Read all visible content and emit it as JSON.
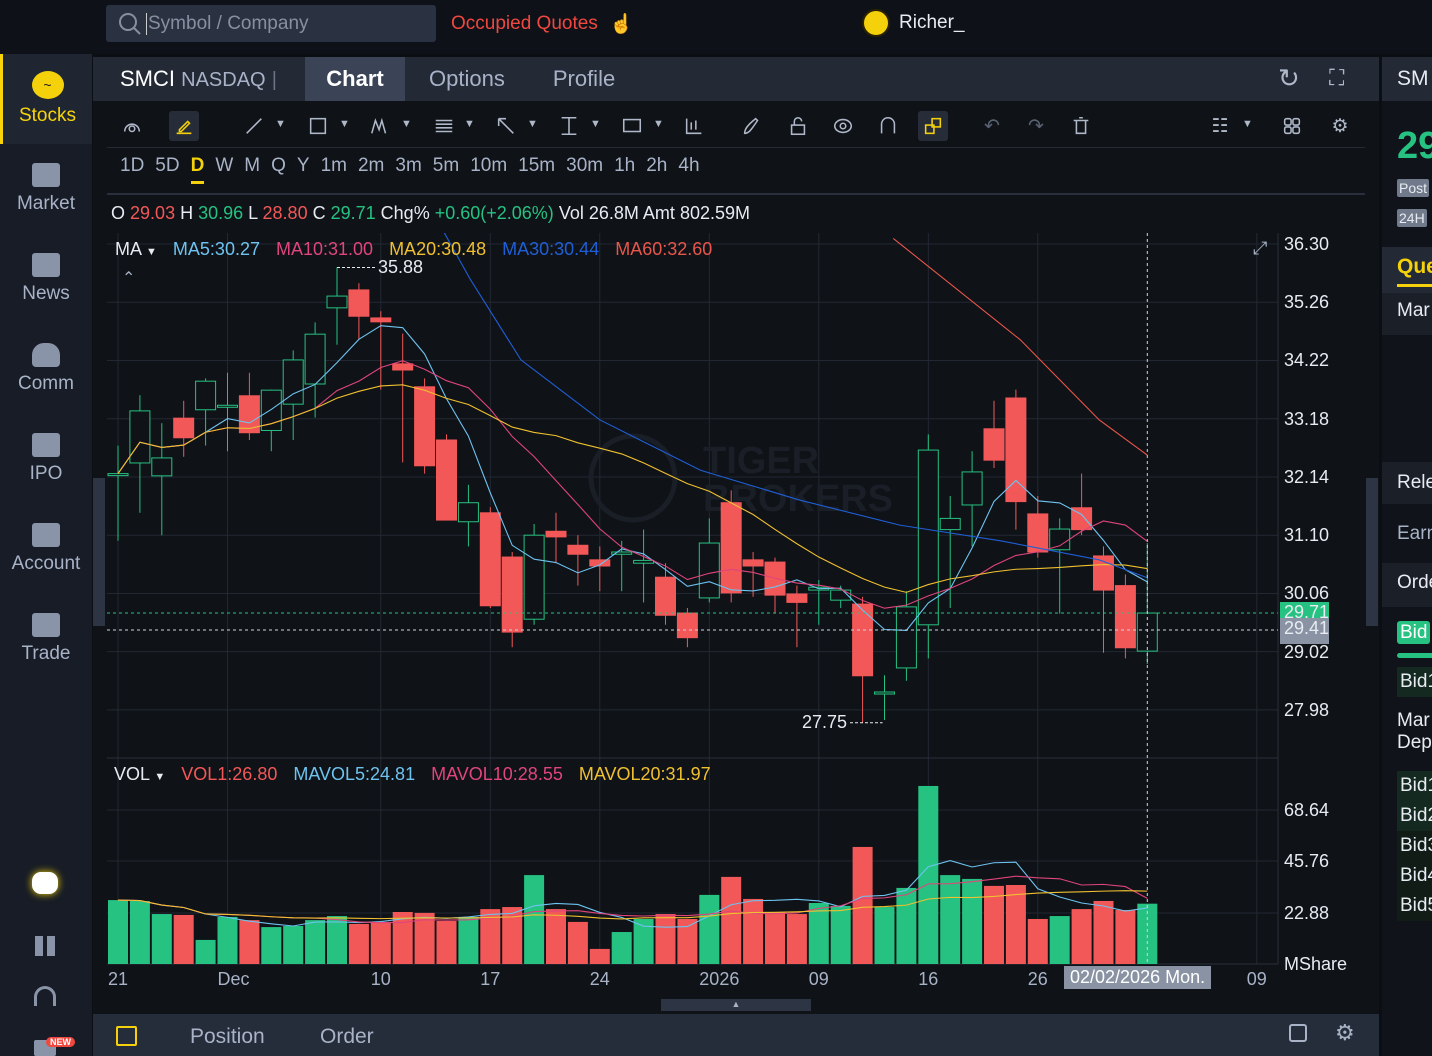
{
  "topbar": {
    "search_placeholder": "Symbol / Company",
    "occupied_quotes": "Occupied Quotes",
    "username": "Richer_"
  },
  "sidebar": {
    "items": [
      {
        "label": "Stocks",
        "icon": "stocks-icon"
      },
      {
        "label": "Market",
        "icon": "market-icon"
      },
      {
        "label": "News",
        "icon": "news-icon"
      },
      {
        "label": "Comm",
        "icon": "community-icon"
      },
      {
        "label": "IPO",
        "icon": "ipo-icon"
      },
      {
        "label": "Account",
        "icon": "wallet-icon"
      },
      {
        "label": "Trade",
        "icon": "trade-icon"
      }
    ],
    "new_badge": "NEW"
  },
  "header": {
    "symbol": "SMCI",
    "exchange": "NASDAQ",
    "tabs": [
      "Chart",
      "Options",
      "Profile"
    ]
  },
  "timeframes": [
    "1D",
    "5D",
    "D",
    "W",
    "M",
    "Q",
    "Y",
    "1m",
    "2m",
    "3m",
    "5m",
    "10m",
    "15m",
    "30m",
    "1h",
    "2h",
    "4h"
  ],
  "active_timeframe": "D",
  "ohlc": {
    "o_label": "O",
    "o": "29.03",
    "h_label": "H",
    "h": "30.96",
    "l_label": "L",
    "l": "28.80",
    "c_label": "C",
    "c": "29.71",
    "chg_label": "Chg%",
    "chg": "+0.60(+2.06%)",
    "vol_label": "Vol",
    "vol": "26.8M",
    "amt_label": "Amt",
    "amt": "802.59M"
  },
  "ma_legend": {
    "label": "MA",
    "ma5": "MA5:30.27",
    "ma10": "MA10:31.00",
    "ma20": "MA20:30.48",
    "ma30": "MA30:30.44",
    "ma60": "MA60:32.60"
  },
  "vol_legend": {
    "label": "VOL",
    "vol1": "VOL1:26.80",
    "mavol5": "MAVOL5:24.81",
    "mavol10": "MAVOL10:28.55",
    "mavol20": "MAVOL20:31.97"
  },
  "colors": {
    "up": "#26c281",
    "down": "#f25858",
    "ma5": "#6ec3f0",
    "ma10": "#e0457b",
    "ma20": "#f0c030",
    "ma30": "#1f5fd6",
    "ma60": "#e8564a",
    "accent": "#f4d10b"
  },
  "chart_data": {
    "type": "candlestick",
    "price_ticks": [
      "36.30",
      "35.26",
      "34.22",
      "33.18",
      "32.14",
      "31.10",
      "30.06",
      "29.02",
      "27.98"
    ],
    "price_range": [
      27.98,
      36.3
    ],
    "last_price": "29.71",
    "crosshair_price": "29.41",
    "high_marker": "35.88",
    "low_marker": "27.75",
    "volume_ticks": [
      "68.64",
      "45.76",
      "22.88"
    ],
    "volume_unit": "MShare",
    "x_labels": [
      {
        "i": 0,
        "t": "21"
      },
      {
        "i": 5,
        "t": "Dec"
      },
      {
        "i": 12,
        "t": "10"
      },
      {
        "i": 17,
        "t": "17"
      },
      {
        "i": 22,
        "t": "24"
      },
      {
        "i": 27,
        "t": "2026"
      },
      {
        "i": 32,
        "t": "09"
      },
      {
        "i": 37,
        "t": "16"
      },
      {
        "i": 42,
        "t": "26"
      },
      {
        "i": 52,
        "t": "09"
      }
    ],
    "crosshair_date": "02/02/2026 Mon.",
    "candles": [
      [
        32.17,
        32.7,
        31.0,
        32.2
      ],
      [
        32.39,
        33.6,
        31.5,
        33.32
      ],
      [
        32.16,
        33.1,
        31.1,
        32.48
      ],
      [
        33.19,
        33.5,
        32.5,
        32.84
      ],
      [
        33.34,
        33.9,
        32.7,
        33.85
      ],
      [
        33.4,
        34.0,
        32.6,
        33.42
      ],
      [
        33.59,
        34.0,
        32.8,
        32.93
      ],
      [
        32.97,
        33.7,
        32.6,
        33.69
      ],
      [
        33.44,
        34.4,
        32.8,
        34.23
      ],
      [
        33.8,
        34.9,
        33.2,
        34.69
      ],
      [
        35.16,
        35.88,
        34.5,
        35.37
      ],
      [
        35.48,
        35.6,
        34.6,
        35.01
      ],
      [
        34.98,
        35.1,
        33.7,
        34.91
      ],
      [
        34.16,
        34.7,
        32.4,
        34.05
      ],
      [
        33.75,
        33.9,
        32.2,
        32.34
      ],
      [
        32.8,
        32.9,
        31.4,
        31.37
      ],
      [
        31.34,
        32.0,
        30.9,
        31.68
      ],
      [
        31.5,
        31.6,
        29.8,
        29.84
      ],
      [
        30.71,
        30.8,
        29.1,
        29.37
      ],
      [
        29.6,
        31.3,
        29.5,
        31.1
      ],
      [
        31.17,
        31.5,
        30.6,
        31.07
      ],
      [
        30.92,
        31.1,
        30.2,
        30.76
      ],
      [
        30.66,
        30.9,
        30.1,
        30.55
      ],
      [
        30.76,
        31.0,
        30.1,
        30.8
      ],
      [
        30.6,
        31.2,
        29.9,
        30.65
      ],
      [
        30.35,
        30.6,
        29.5,
        29.67
      ],
      [
        29.71,
        29.8,
        29.1,
        29.27
      ],
      [
        29.98,
        31.4,
        29.9,
        30.96
      ],
      [
        31.68,
        31.9,
        29.9,
        30.07
      ],
      [
        30.66,
        30.8,
        30.0,
        30.55
      ],
      [
        30.62,
        30.7,
        29.7,
        30.03
      ],
      [
        30.05,
        30.2,
        29.1,
        29.9
      ],
      [
        30.12,
        30.3,
        29.5,
        30.17
      ],
      [
        29.94,
        30.2,
        29.8,
        30.12
      ],
      [
        29.87,
        30.0,
        27.75,
        28.59
      ],
      [
        28.27,
        28.6,
        27.8,
        28.3
      ],
      [
        28.73,
        30.1,
        28.5,
        29.82
      ],
      [
        29.5,
        32.9,
        28.9,
        32.62
      ],
      [
        31.2,
        31.8,
        29.8,
        31.4
      ],
      [
        31.64,
        32.6,
        30.9,
        32.23
      ],
      [
        33.0,
        33.5,
        32.3,
        32.44
      ],
      [
        33.55,
        33.7,
        31.2,
        31.7
      ],
      [
        31.48,
        31.8,
        30.7,
        30.8
      ],
      [
        30.84,
        31.4,
        29.7,
        31.21
      ],
      [
        31.59,
        32.2,
        31.1,
        31.2
      ],
      [
        30.73,
        30.9,
        29.0,
        30.12
      ],
      [
        30.2,
        30.4,
        28.9,
        29.09
      ],
      [
        29.03,
        30.96,
        28.8,
        29.71
      ]
    ],
    "volumes": [
      28.4,
      28,
      22.2,
      21.8,
      10.7,
      20.9,
      19.5,
      16.4,
      16.9,
      19.5,
      21.3,
      17.8,
      18.7,
      23.1,
      22.7,
      19.1,
      20.9,
      24.4,
      25.3,
      39.5,
      24.4,
      18.7,
      6.7,
      14.2,
      20,
      22.2,
      20,
      30.7,
      38.7,
      28.9,
      23.1,
      22.2,
      27.1,
      25.8,
      52,
      25.3,
      33.8,
      79.1,
      39.5,
      37.8,
      34.7,
      35.1,
      20,
      21.3,
      24.4,
      28,
      24,
      26.8
    ],
    "ma30_points": [
      [
        14.9,
        36.5
      ],
      [
        16.1,
        35.66
      ],
      [
        18.4,
        34.23
      ],
      [
        22,
        33.16
      ],
      [
        26.6,
        32.26
      ],
      [
        31.1,
        31.73
      ],
      [
        35.7,
        31.28
      ],
      [
        40.3,
        31.0
      ],
      [
        44.8,
        30.66
      ],
      [
        47,
        30.34
      ]
    ],
    "ma60_points": [
      [
        35.4,
        36.4
      ],
      [
        41.2,
        34.59
      ],
      [
        44.8,
        33.16
      ],
      [
        47,
        32.53
      ]
    ]
  },
  "bottom": {
    "position": "Position",
    "order": "Order"
  },
  "right_panel": {
    "symbol": "SM",
    "price": "29",
    "post": "Post",
    "h24": "24H",
    "quote_tab": "Que",
    "market": "Mar",
    "related": "Rele",
    "earnings": "Earn",
    "order": "Orde",
    "bid": "Bid",
    "bid1_top": "Bid1",
    "market_depth_1": "Mar",
    "market_depth_2": "Dep",
    "bids": [
      "Bid1",
      "Bid2",
      "Bid3",
      "Bid4",
      "Bid5"
    ]
  }
}
